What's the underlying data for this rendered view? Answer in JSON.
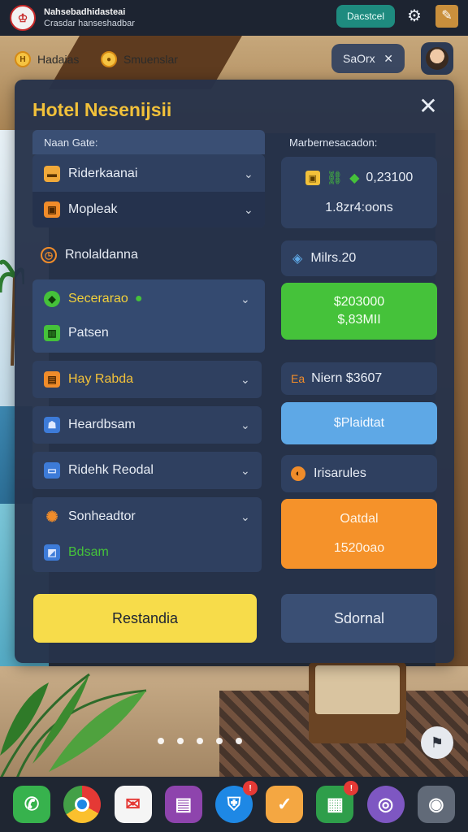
{
  "statusbar": {
    "app_title": "Nahsebadhidasteai",
    "app_subtitle": "Crasdar hanseshadbar",
    "action_label": "Dacstcel"
  },
  "toolbar": {
    "chip1_label": "Hadaias",
    "chip1_icon": "H",
    "chip2_label": "Smuenslar",
    "search_label": "SaOrx",
    "search_clear": "✕"
  },
  "panel": {
    "title": "Hotel Nesenijsii",
    "close_icon": "✕",
    "left_header": "Naan Gate:",
    "right_header": "Marbernesacadon:",
    "left": {
      "row1": "Riderkaanai",
      "row2": "Mopleak",
      "row3": "Rnolaldanna",
      "row4": "Secerarao",
      "row5": "Patsen",
      "row6": "Hay Rabda",
      "row7": "Heardbsam",
      "row8": "Ridehk Reodal",
      "row9": "Sonheadtor",
      "row10": "Bdsam"
    },
    "right": {
      "box1_value": "0,23100",
      "box1_sub": "1.8zr4:oons",
      "row_milrs": "Milrs.20",
      "green_line1": "$203000",
      "green_line2": "$,83MII",
      "row_niern": "Niern $3607",
      "row_niern_icon": "Ea",
      "blue_label": "$Plaidtat",
      "row_irisarules": "Irisarules",
      "orange_line1": "Oatdal",
      "orange_line2": "1520oao"
    },
    "primary_button": "Restandia",
    "secondary_button": "Sdornal"
  },
  "colors": {
    "accent_yellow": "#f2c13a",
    "green": "#45c23a",
    "blue": "#5ea8e6",
    "orange": "#f5922a",
    "teal": "#1e8b7f"
  }
}
